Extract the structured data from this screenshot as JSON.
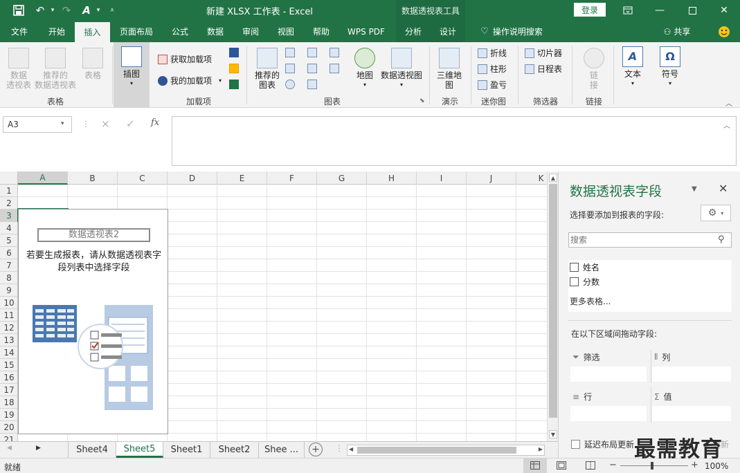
{
  "titlebar": {
    "title": "新建 XLSX 工作表  -  Excel",
    "context_tool": "数据透视表工具",
    "login": "登录",
    "save_icon": "save-icon",
    "undo_icon": "undo-icon",
    "redo_icon": "redo-icon",
    "format_icon": "format-painter-icon",
    "customize_icon": "customize-qat-icon"
  },
  "tabs": [
    "文件",
    "开始",
    "插入",
    "页面布局",
    "公式",
    "数据",
    "审阅",
    "视图",
    "帮助",
    "WPS PDF",
    "分析",
    "设计"
  ],
  "tell_me": "操作说明搜索",
  "share": "共享",
  "ribbon": {
    "tables": {
      "label": "表格",
      "pivot": "数据\n透视表",
      "recommended_pivot": "推荐的\n数据透视表",
      "table": "表格"
    },
    "illustrations": {
      "label": "插图"
    },
    "addins": {
      "label": "加载项",
      "get": "获取加载项",
      "my": "我的加载项"
    },
    "charts": {
      "label": "图表",
      "recommended": "推荐的\n图表",
      "map": "地图",
      "pivot_chart": "数据透视图"
    },
    "tours": {
      "label": "演示",
      "map3d": "三维地\n图"
    },
    "sparklines": {
      "label": "迷你图",
      "line": "折线",
      "column": "柱形",
      "winloss": "盈亏"
    },
    "filters": {
      "label": "筛选器",
      "slicer": "切片器",
      "timeline": "日程表"
    },
    "links": {
      "label": "链接",
      "link": "链\n接"
    },
    "text": {
      "label": "文本"
    },
    "symbols": {
      "label": "符号"
    }
  },
  "formula_bar": {
    "name_box": "A3",
    "fx": "fx",
    "cancel": "×",
    "enter": "✓"
  },
  "grid": {
    "columns": [
      "A",
      "B",
      "C",
      "D",
      "E",
      "F",
      "G",
      "H",
      "I",
      "J",
      "K"
    ],
    "rows": [
      "1",
      "2",
      "3",
      "4",
      "5",
      "6",
      "7",
      "8",
      "9",
      "10",
      "11",
      "12",
      "13",
      "14",
      "15",
      "16",
      "17",
      "18",
      "19",
      "20",
      "21"
    ],
    "active_cell": "A3"
  },
  "pivot_placeholder": {
    "name": "数据透视表2",
    "message": "若要生成报表，请从数据透视表字段列表中选择字段"
  },
  "sheets": [
    "Sheet4",
    "Sheet5",
    "Sheet1",
    "Sheet2",
    "Shee ..."
  ],
  "active_sheet": "Sheet5",
  "status": {
    "ready": "就绪",
    "zoom": "100%"
  },
  "pane": {
    "title": "数据透视表字段",
    "subtitle": "选择要添加到报表的字段:",
    "search_placeholder": "搜索",
    "fields": [
      "姓名",
      "分数"
    ],
    "more_tables": "更多表格...",
    "drag_label": "在以下区域间拖动字段:",
    "zones": {
      "filter": "筛选",
      "columns": "列",
      "rows": "行",
      "values": "值"
    },
    "defer": "延迟布局更新",
    "update": "更新"
  },
  "watermark": "最需教育",
  "colors": {
    "excel_green": "#217346",
    "ribbon_bg": "#f3f3f3",
    "pane_bg": "#f3f3f3"
  }
}
